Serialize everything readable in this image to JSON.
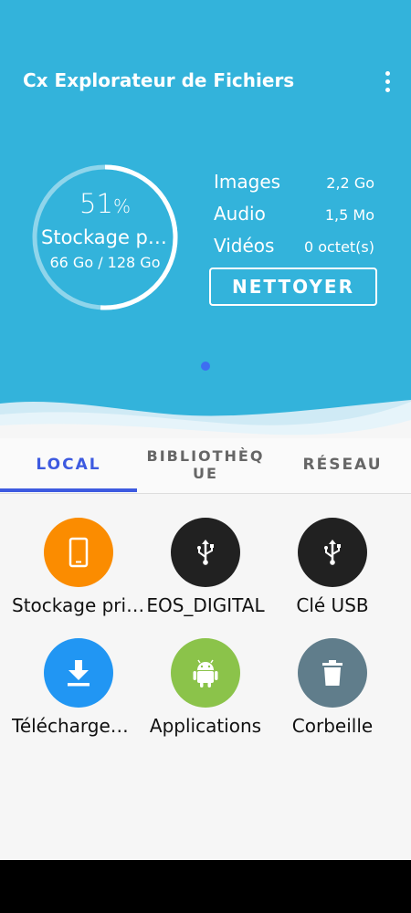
{
  "app": {
    "title": "Cx Explorateur de Fichiers",
    "menu_icon": "more-vert-icon"
  },
  "storage": {
    "percent": "51",
    "percent_sign": "%",
    "fill_fraction": 0.51,
    "label": "Stockage principal",
    "size": "66 Go / 128 Go"
  },
  "stats": [
    {
      "label": "Images",
      "value": "2,2 Go"
    },
    {
      "label": "Audio",
      "value": "1,5 Mo"
    },
    {
      "label": "Vidéos",
      "value": "0 octet(s)"
    }
  ],
  "clean_button": "NETTOYER",
  "tabs": [
    {
      "label": "LOCAL",
      "active": true
    },
    {
      "label": "BIBLIOTHÈQUE",
      "active": false
    },
    {
      "label": "RÉSEAU",
      "active": false
    }
  ],
  "items": [
    {
      "label": "Stockage principal",
      "icon": "phone-icon",
      "color": "#fb8c00"
    },
    {
      "label": "EOS_DIGITAL",
      "icon": "usb-icon",
      "color": "#212121"
    },
    {
      "label": "Clé USB",
      "icon": "usb-icon",
      "color": "#212121"
    },
    {
      "label": "Téléchargements",
      "icon": "download-icon",
      "color": "#2196f3"
    },
    {
      "label": "Applications",
      "icon": "android-icon",
      "color": "#8bc34a"
    },
    {
      "label": "Corbeille",
      "icon": "trash-icon",
      "color": "#607d8b"
    }
  ],
  "colors": {
    "header": "#33b3db",
    "accent": "#3d5ae0",
    "page_dot": "#3d6ef2"
  }
}
